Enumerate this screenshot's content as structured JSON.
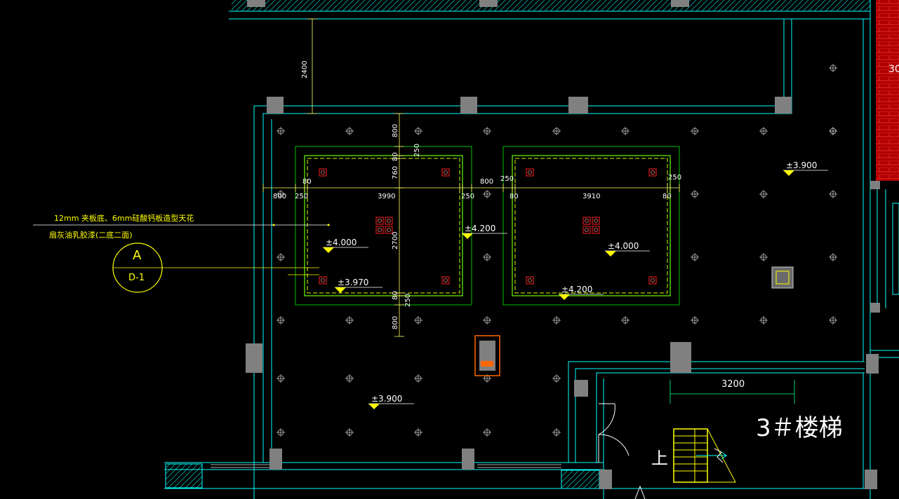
{
  "annotation": {
    "line1": "12mm 夹板底、6mm硅酸钙板造型天花",
    "line2": "扇灰油乳胶漆(二底二面)"
  },
  "section_marker": {
    "letter": "A",
    "ref": "D-1"
  },
  "stair_label": "3＃楼梯",
  "stair_up": "上",
  "edge_fragment": "30",
  "levels": {
    "top_right": "±3.900",
    "box1_center": "±4.000",
    "box1_rim": "±3.970",
    "between": "±4.200",
    "box2_center": "±4.000",
    "box2_bottom": "±4.200",
    "bottom_left": "±3.900"
  },
  "dimensions": {
    "corridor_gap": "2400",
    "top_800": "800",
    "top_80": "80",
    "top_250": "250",
    "box_760": "760",
    "left_800": "800",
    "left_250": "250",
    "left_80": "80",
    "width_box1": "3990",
    "right_250_a": "250",
    "middle_800": "800",
    "middle_250": "250",
    "middle_80": "80",
    "width_box2": "3910",
    "right_80": "80",
    "right_250_b": "250",
    "height_2700": "2700",
    "bottom_80": "80",
    "bottom_250": "250",
    "bottom_800": "800",
    "stair_width": "3200"
  },
  "colors": {
    "wall": "#00ffff",
    "ceiling_edge": "#00ff00",
    "dimension": "#ffff00",
    "column": "#808080",
    "light_fixture": "#ff0000",
    "access_panel": "#ff6600",
    "lamp_symbol": "#bbbbbb"
  }
}
